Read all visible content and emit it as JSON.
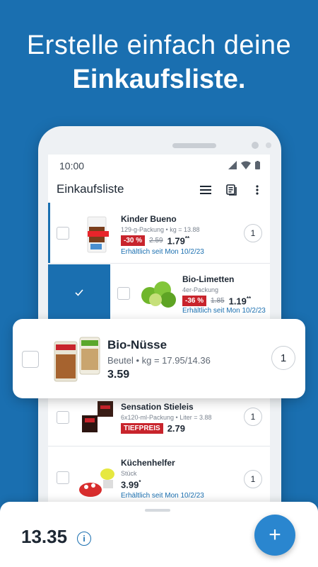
{
  "headline": {
    "line1": "Erstelle einfach deine",
    "line2": "Einkaufsliste."
  },
  "statusbar": {
    "time": "10:00"
  },
  "appbar": {
    "title": "Einkaufsliste"
  },
  "items": [
    {
      "name": "Kinder Bueno",
      "sub": "129-g-Packung • kg = 13.88",
      "badge": "-30 %",
      "old_price": "2.59",
      "price": "1.79",
      "price_mark": "**",
      "avail": "Erhältlich seit Mon 10/2/23",
      "qty": "1"
    },
    {
      "name": "Bio-Limetten",
      "sub": "4er-Packung",
      "badge": "-36 %",
      "old_price": "1.85",
      "price": "1.19",
      "price_mark": "**",
      "avail": "Erhältlich seit Mon 10/2/23",
      "qty": "1",
      "checked": true
    },
    {
      "name": "Sensation Stieleis",
      "sub": "6x120-ml-Packung • Liter = 3.88",
      "badge": "TIEFPREIS",
      "price": "2.79",
      "qty": "1"
    },
    {
      "name": "Küchenhelfer",
      "sub": "Stück",
      "price": "3.99",
      "price_mark": "*",
      "avail": "Erhältlich seit Mon 10/2/23",
      "qty": "1"
    }
  ],
  "dragged": {
    "name": "Bio-Nüsse",
    "sub": "Beutel • kg = 17.95/14.36",
    "price": "3.59",
    "qty": "1"
  },
  "footer": {
    "total": "13.35",
    "info_glyph": "i",
    "fab_glyph": "+"
  },
  "colors": {
    "brand_blue": "#1a6fb0",
    "discount_red": "#c8242c",
    "fab": "#2a86cf"
  }
}
